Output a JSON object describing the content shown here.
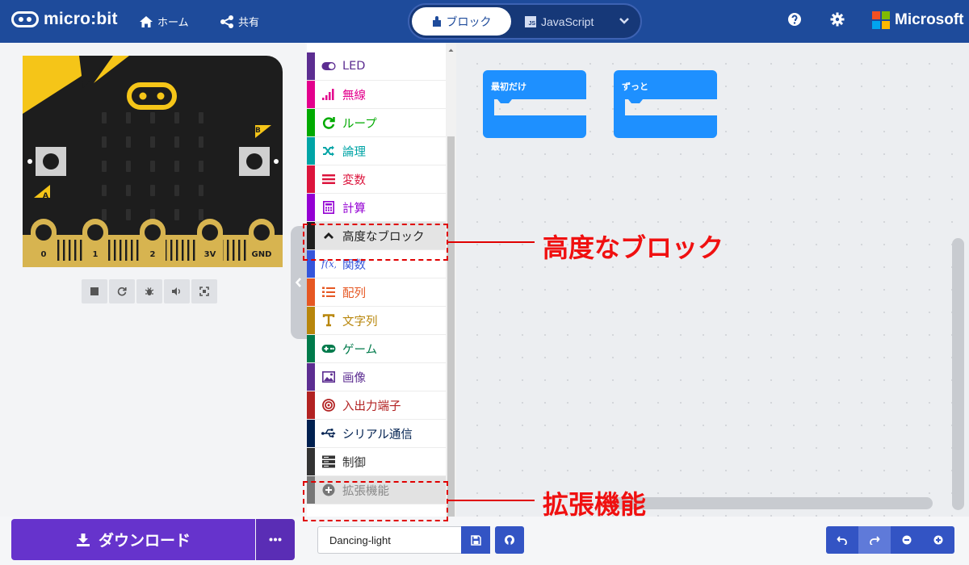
{
  "header": {
    "brand": "micro:bit",
    "home": "ホーム",
    "share": "共有",
    "blocks_tab": "ブロック",
    "js_tab": "JavaScript",
    "js_badge": "JS",
    "microsoft": "Microsoft"
  },
  "simulator": {
    "button_a": "A",
    "button_b": "B",
    "pins": [
      "0",
      "1",
      "2",
      "3V",
      "GND"
    ]
  },
  "toolbox": {
    "items": [
      {
        "label": "LED",
        "color": "#5c2d91",
        "icon": "toggle-icon"
      },
      {
        "label": "無線",
        "color": "#e3008c",
        "icon": "signal-icon"
      },
      {
        "label": "ループ",
        "color": "#00aa00",
        "icon": "refresh-icon"
      },
      {
        "label": "論理",
        "color": "#00a4a6",
        "icon": "shuffle-icon"
      },
      {
        "label": "変数",
        "color": "#dc143c",
        "icon": "list-icon"
      },
      {
        "label": "計算",
        "color": "#9400d3",
        "icon": "calculator-icon"
      },
      {
        "label": "高度なブロック",
        "color": "#1e1e1e",
        "icon": "chevron-up-icon"
      },
      {
        "label": "関数",
        "color": "#3455db",
        "icon": "function-icon"
      },
      {
        "label": "配列",
        "color": "#e65722",
        "icon": "numbered-list-icon"
      },
      {
        "label": "文字列",
        "color": "#b8860b",
        "icon": "text-icon"
      },
      {
        "label": "ゲーム",
        "color": "#007a4b",
        "icon": "gamepad-icon"
      },
      {
        "label": "画像",
        "color": "#5c2d91",
        "icon": "image-icon"
      },
      {
        "label": "入出力端子",
        "color": "#b22222",
        "icon": "target-icon"
      },
      {
        "label": "シリアル通信",
        "color": "#002050",
        "icon": "usb-icon"
      },
      {
        "label": "制御",
        "color": "#333333",
        "icon": "server-icon"
      },
      {
        "label": "拡張機能",
        "color": "#777777",
        "icon": "plus-circle-icon"
      }
    ]
  },
  "workspace": {
    "blocks": [
      {
        "label": "最初だけ",
        "color": "#1e90ff"
      },
      {
        "label": "ずっと",
        "color": "#1e90ff"
      }
    ]
  },
  "annotations": {
    "advanced": "高度なブロック",
    "extensions": "拡張機能"
  },
  "bottom": {
    "download": "ダウンロード",
    "project_name": "Dancing-light"
  }
}
